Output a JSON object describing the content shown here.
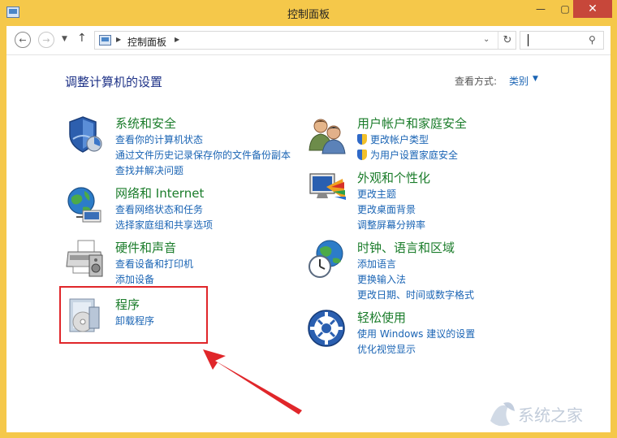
{
  "window": {
    "title": "控制面板",
    "minimize_label": "—",
    "maximize_label": "▢",
    "close_label": "✕"
  },
  "address": {
    "breadcrumb": "控制面板",
    "search_placeholder": ""
  },
  "main": {
    "heading": "调整计算机的设置",
    "view_by_label": "查看方式:",
    "view_by_value": "类别"
  },
  "categories": [
    {
      "title": "系统和安全",
      "icon": "shield-icon",
      "links": [
        "查看你的计算机状态",
        "通过文件历史记录保存你的文件备份副本",
        "查找并解决问题"
      ]
    },
    {
      "title": "网络和 Internet",
      "icon": "network-globe-icon",
      "links": [
        "查看网络状态和任务",
        "选择家庭组和共享选项"
      ]
    },
    {
      "title": "硬件和声音",
      "icon": "printer-icon",
      "links": [
        "查看设备和打印机",
        "添加设备"
      ]
    },
    {
      "title": "程序",
      "icon": "programs-disc-icon",
      "links": [
        "卸载程序"
      ]
    },
    {
      "title": "用户帐户和家庭安全",
      "icon": "users-icon",
      "links": [
        "更改帐户类型",
        "为用户设置家庭安全"
      ]
    },
    {
      "title": "外观和个性化",
      "icon": "monitor-palette-icon",
      "links": [
        "更改主题",
        "更改桌面背景",
        "调整屏幕分辨率"
      ]
    },
    {
      "title": "时钟、语言和区域",
      "icon": "clock-globe-icon",
      "links": [
        "添加语言",
        "更换输入法",
        "更改日期、时间或数字格式"
      ]
    },
    {
      "title": "轻松使用",
      "icon": "ease-of-access-icon",
      "links": [
        "使用 Windows 建议的设置",
        "优化视觉显示"
      ]
    }
  ],
  "colors": {
    "title_bar": "#f5c84a",
    "close_button": "#c7473a",
    "category_title": "#1a7c2a",
    "link": "#1a64b4",
    "annotation": "#e0262a"
  },
  "watermark": "系统之家"
}
